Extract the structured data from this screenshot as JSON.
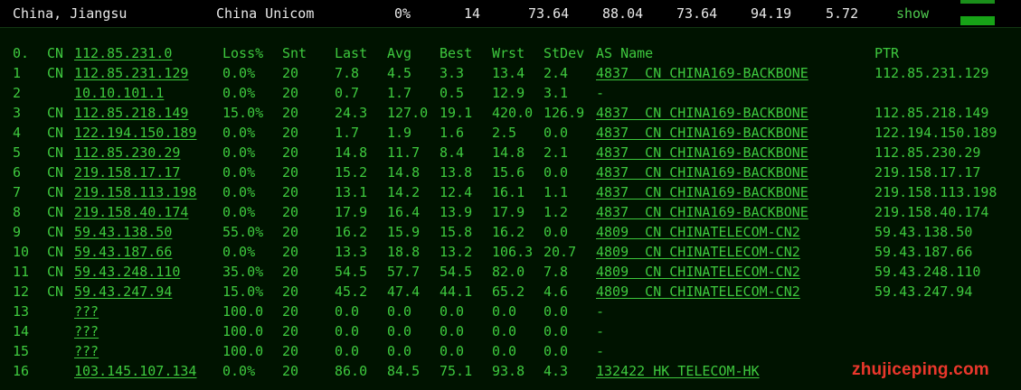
{
  "summary": {
    "location": "China, Jiangsu",
    "isp": "China Unicom",
    "loss": "0%",
    "sent": "14",
    "last": "73.64",
    "avg": "88.04",
    "best": "73.64",
    "worst": "94.19",
    "stdev": "5.72",
    "toggle_label": "show"
  },
  "columns": {
    "hop": "0.",
    "cc": "CN",
    "host": "112.85.231.0",
    "loss": "Loss%",
    "snt": "Snt",
    "last": "Last",
    "avg": "Avg",
    "best": "Best",
    "wrst": "Wrst",
    "stdev": "StDev",
    "as_name": "AS Name",
    "ptr": "PTR"
  },
  "hops": [
    {
      "hop": "1",
      "cc": "CN",
      "host": "112.85.231.129",
      "loss": "0.0%",
      "snt": "20",
      "last": "7.8",
      "avg": "4.5",
      "best": "3.3",
      "wrst": "13.4",
      "stdev": "2.4",
      "as_name": "4837  CN CHINA169-BACKBONE",
      "ptr": "112.85.231.129"
    },
    {
      "hop": "2",
      "cc": "",
      "host": "10.10.101.1",
      "loss": "0.0%",
      "snt": "20",
      "last": "0.7",
      "avg": "1.7",
      "best": "0.5",
      "wrst": "12.9",
      "stdev": "3.1",
      "as_name": "-",
      "ptr": ""
    },
    {
      "hop": "3",
      "cc": "CN",
      "host": "112.85.218.149",
      "loss": "15.0%",
      "snt": "20",
      "last": "24.3",
      "avg": "127.0",
      "best": "19.1",
      "wrst": "420.0",
      "stdev": "126.9",
      "as_name": "4837  CN CHINA169-BACKBONE",
      "ptr": "112.85.218.149"
    },
    {
      "hop": "4",
      "cc": "CN",
      "host": "122.194.150.189",
      "loss": "0.0%",
      "snt": "20",
      "last": "1.7",
      "avg": "1.9",
      "best": "1.6",
      "wrst": "2.5",
      "stdev": "0.0",
      "as_name": "4837  CN CHINA169-BACKBONE",
      "ptr": "122.194.150.189"
    },
    {
      "hop": "5",
      "cc": "CN",
      "host": "112.85.230.29",
      "loss": "0.0%",
      "snt": "20",
      "last": "14.8",
      "avg": "11.7",
      "best": "8.4",
      "wrst": "14.8",
      "stdev": "2.1",
      "as_name": "4837  CN CHINA169-BACKBONE",
      "ptr": "112.85.230.29"
    },
    {
      "hop": "6",
      "cc": "CN",
      "host": "219.158.17.17",
      "loss": "0.0%",
      "snt": "20",
      "last": "15.2",
      "avg": "14.8",
      "best": "13.8",
      "wrst": "15.6",
      "stdev": "0.0",
      "as_name": "4837  CN CHINA169-BACKBONE",
      "ptr": "219.158.17.17"
    },
    {
      "hop": "7",
      "cc": "CN",
      "host": "219.158.113.198",
      "loss": "0.0%",
      "snt": "20",
      "last": "13.1",
      "avg": "14.2",
      "best": "12.4",
      "wrst": "16.1",
      "stdev": "1.1",
      "as_name": "4837  CN CHINA169-BACKBONE",
      "ptr": "219.158.113.198"
    },
    {
      "hop": "8",
      "cc": "CN",
      "host": "219.158.40.174",
      "loss": "0.0%",
      "snt": "20",
      "last": "17.9",
      "avg": "16.4",
      "best": "13.9",
      "wrst": "17.9",
      "stdev": "1.2",
      "as_name": "4837  CN CHINA169-BACKBONE",
      "ptr": "219.158.40.174"
    },
    {
      "hop": "9",
      "cc": "CN",
      "host": "59.43.138.50",
      "loss": "55.0%",
      "snt": "20",
      "last": "16.2",
      "avg": "15.9",
      "best": "15.8",
      "wrst": "16.2",
      "stdev": "0.0",
      "as_name": "4809  CN CHINATELECOM-CN2",
      "ptr": "59.43.138.50"
    },
    {
      "hop": "10",
      "cc": "CN",
      "host": "59.43.187.66",
      "loss": "0.0%",
      "snt": "20",
      "last": "13.3",
      "avg": "18.8",
      "best": "13.2",
      "wrst": "106.3",
      "stdev": "20.7",
      "as_name": "4809  CN CHINATELECOM-CN2",
      "ptr": "59.43.187.66"
    },
    {
      "hop": "11",
      "cc": "CN",
      "host": "59.43.248.110",
      "loss": "35.0%",
      "snt": "20",
      "last": "54.5",
      "avg": "57.7",
      "best": "54.5",
      "wrst": "82.0",
      "stdev": "7.8",
      "as_name": "4809  CN CHINATELECOM-CN2",
      "ptr": "59.43.248.110"
    },
    {
      "hop": "12",
      "cc": "CN",
      "host": "59.43.247.94",
      "loss": "15.0%",
      "snt": "20",
      "last": "45.2",
      "avg": "47.4",
      "best": "44.1",
      "wrst": "65.2",
      "stdev": "4.6",
      "as_name": "4809  CN CHINATELECOM-CN2",
      "ptr": "59.43.247.94"
    },
    {
      "hop": "13",
      "cc": "",
      "host": "???",
      "loss": "100.0",
      "snt": "20",
      "last": "0.0",
      "avg": "0.0",
      "best": "0.0",
      "wrst": "0.0",
      "stdev": "0.0",
      "as_name": "-",
      "ptr": ""
    },
    {
      "hop": "14",
      "cc": "",
      "host": "???",
      "loss": "100.0",
      "snt": "20",
      "last": "0.0",
      "avg": "0.0",
      "best": "0.0",
      "wrst": "0.0",
      "stdev": "0.0",
      "as_name": "-",
      "ptr": ""
    },
    {
      "hop": "15",
      "cc": "",
      "host": "???",
      "loss": "100.0",
      "snt": "20",
      "last": "0.0",
      "avg": "0.0",
      "best": "0.0",
      "wrst": "0.0",
      "stdev": "0.0",
      "as_name": "-",
      "ptr": ""
    },
    {
      "hop": "16",
      "cc": "",
      "host": "103.145.107.134",
      "loss": "0.0%",
      "snt": "20",
      "last": "86.0",
      "avg": "84.5",
      "best": "75.1",
      "wrst": "93.8",
      "stdev": "4.3",
      "as_name": "132422 HK TELECOM-HK",
      "ptr": ""
    }
  ],
  "watermark": "zhujiceping.com",
  "colors": {
    "text": "#3ec93e",
    "header_text": "#e8e8e8",
    "panel_bg": "#001300",
    "watermark": "#ff3b30"
  }
}
